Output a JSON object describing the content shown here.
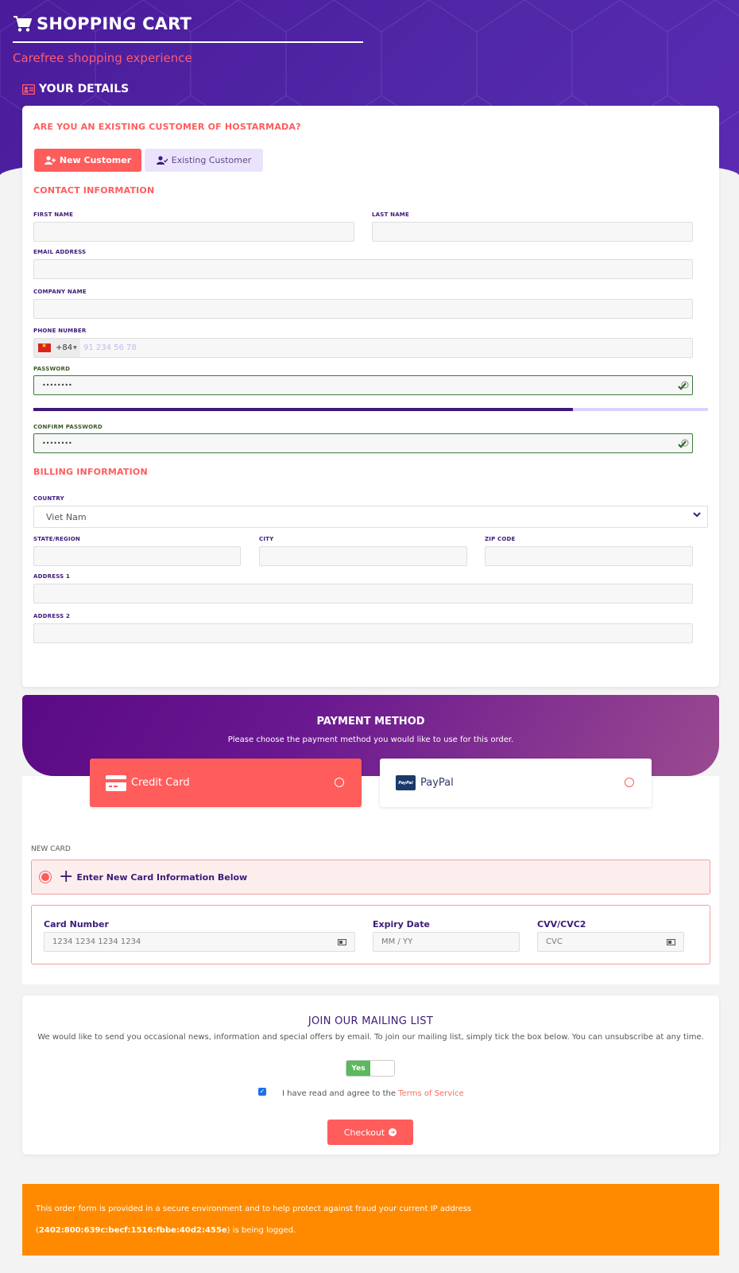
{
  "header": {
    "title": "SHOPPING CART",
    "subtitle": "Carefree shopping experience",
    "section_title": "YOUR DETAILS",
    "icons": {
      "title": "cart-icon",
      "section": "id-card-icon"
    }
  },
  "customer_type": {
    "question": "ARE YOU AN EXISTING CUSTOMER OF HOSTARMADA?",
    "new_label": "New Customer",
    "existing_label": "Existing Customer",
    "selected": "new"
  },
  "contact": {
    "title": "CONTACT INFORMATION",
    "first_name": {
      "label": "FIRST NAME",
      "value": ""
    },
    "last_name": {
      "label": "LAST NAME",
      "value": ""
    },
    "email": {
      "label": "EMAIL ADDRESS",
      "value": ""
    },
    "company": {
      "label": "COMPANY NAME",
      "value": ""
    },
    "phone": {
      "label": "PHONE NUMBER",
      "country_code": "+84",
      "placeholder": "91 234 56 78",
      "value": ""
    },
    "password": {
      "label": "PASSWORD",
      "value": "••••••••",
      "strength_percent": 80
    },
    "confirm_password": {
      "label": "CONFIRM PASSWORD",
      "value": "••••••••"
    }
  },
  "billing": {
    "title": "BILLING INFORMATION",
    "country": {
      "label": "COUNTRY",
      "value": "Viet Nam"
    },
    "state": {
      "label": "STATE/REGION",
      "value": ""
    },
    "city": {
      "label": "CITY",
      "value": ""
    },
    "zip": {
      "label": "ZIP CODE",
      "value": ""
    },
    "address1": {
      "label": "ADDRESS 1",
      "value": ""
    },
    "address2": {
      "label": "ADDRESS 2",
      "value": ""
    }
  },
  "payment": {
    "title": "PAYMENT METHOD",
    "subtitle": "Please choose the payment method you would like to use for this order.",
    "options": [
      {
        "label": "Credit Card",
        "icon": "credit-card-icon",
        "selected": true
      },
      {
        "label": "PayPal",
        "icon": "paypal-icon",
        "logo_text": "PayPal",
        "selected": false
      }
    ],
    "new_card_label": "NEW CARD",
    "new_card_option": "Enter New Card Information Below",
    "card_number": {
      "label": "Card Number",
      "placeholder": "1234 1234 1234 1234"
    },
    "expiry": {
      "label": "Expiry Date",
      "placeholder": "MM / YY"
    },
    "cvv": {
      "label": "CVV/CVC2",
      "placeholder": "CVC"
    }
  },
  "mailing": {
    "title": "JOIN OUR MAILING LIST",
    "text": "We would like to send you occasional news, information and special offers by email. To join our mailing list, simply tick the box below. You can unsubscribe at any time.",
    "toggle_label": "Yes",
    "toggle_on": true,
    "tos_text": "I have read and agree to the",
    "tos_link": "Terms of Service",
    "tos_checked": true,
    "checkout_label": "Checkout"
  },
  "notice": {
    "line1": "This order form is provided in a secure environment and to help protect against fraud your current IP address",
    "ip": "2402:800:639c:becf:1516:fbbe:40d2:455e",
    "line2_suffix": " is being logged."
  },
  "colors": {
    "brand_purple": "#4a1b9a",
    "accent_red": "#ff5c5c",
    "label_purple": "#3d1a7a",
    "notice_orange": "#ff8a00",
    "valid_green": "#3a7a3a"
  }
}
